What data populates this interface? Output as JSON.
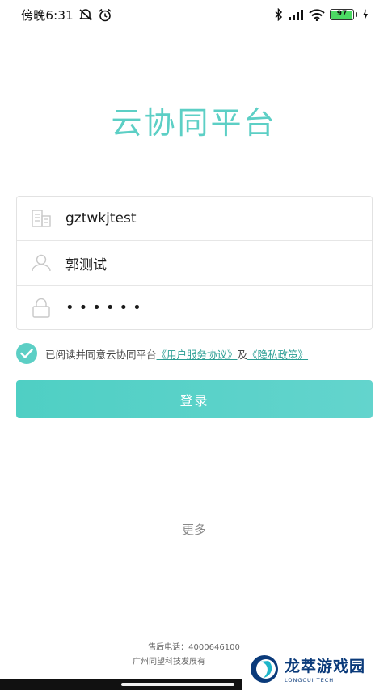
{
  "status_bar": {
    "time": "傍晚6:31",
    "battery": "97"
  },
  "app": {
    "title": "云协同平台"
  },
  "form": {
    "company": "gztwkjtest",
    "username": "郭测试",
    "password": "••••••"
  },
  "agreement": {
    "prefix": "已阅读并同意云协同平台",
    "service_link": "《用户服务协议》",
    "conjunction": "及",
    "privacy_link": "《隐私政策》",
    "checked": true
  },
  "login_button": "登录",
  "more_link": "更多",
  "footer": {
    "phone": "售后电话：4000646100",
    "company": "广州同望科技发展有"
  },
  "watermark": {
    "cn": "龙萃游戏园",
    "en": "LONGCUI TECH"
  },
  "colors": {
    "accent": "#5ccfc5",
    "link": "#2a9d93"
  }
}
